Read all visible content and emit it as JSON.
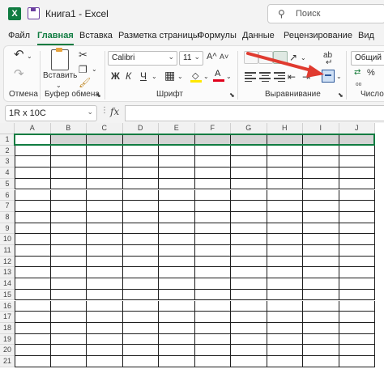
{
  "app": {
    "title": "Книга1  -  Excel",
    "search_placeholder": "Поиск",
    "accent": "#107c41",
    "arrow_color": "#e03a2f"
  },
  "tabs": [
    {
      "label": "Файл"
    },
    {
      "label": "Главная",
      "active": true
    },
    {
      "label": "Вставка"
    },
    {
      "label": "Разметка страницы"
    },
    {
      "label": "Формулы"
    },
    {
      "label": "Данные"
    },
    {
      "label": "Рецензирование"
    },
    {
      "label": "Вид"
    }
  ],
  "ribbon": {
    "undo_label": "Отмена",
    "paste_label": "Вставить",
    "clipboard_label": "Буфер обмена",
    "font_name": "Calibri",
    "font_size": "11",
    "font_group_label": "Шрифт",
    "bold": "Ж",
    "italic": "К",
    "underline": "Ч",
    "font_color_letter": "А",
    "grow_font": "A^",
    "shrink_font": "A˅",
    "align_group_label": "Выравнивание",
    "number_format": "Общий",
    "number_group_label": "Число",
    "percent": "%",
    "wrap_label": "ab"
  },
  "formula_bar": {
    "name_box": "1R x 10C",
    "fx": "fx",
    "value": ""
  },
  "grid": {
    "columns": [
      "A",
      "B",
      "C",
      "D",
      "E",
      "F",
      "G",
      "H",
      "I",
      "J"
    ],
    "rows": [
      "1",
      "2",
      "3",
      "4",
      "5",
      "6",
      "7",
      "8",
      "9",
      "10",
      "11",
      "12",
      "13",
      "14",
      "15",
      "16",
      "17",
      "18",
      "19",
      "20",
      "21"
    ]
  }
}
